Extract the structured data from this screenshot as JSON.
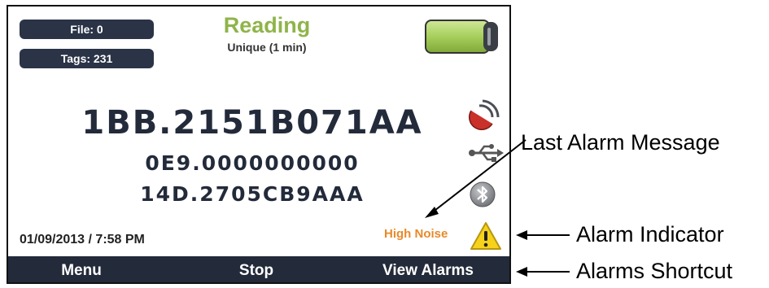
{
  "header": {
    "file_label": "File: 0",
    "tags_label": "Tags: 231",
    "status_title": "Reading",
    "status_subtitle": "Unique (1 min)"
  },
  "battery": {
    "level": 1.0,
    "color": "#a7cf5b"
  },
  "tags": {
    "main": "1BB.2151B071AA",
    "secondary_1": "0E9.0000000000",
    "secondary_2": "14D.2705CB9AAA"
  },
  "status_icons": [
    "antenna-icon",
    "usb-icon",
    "bluetooth-icon"
  ],
  "footer_info": {
    "datetime": "01/09/2013  /  7:58 PM",
    "alarm_message": "High Noise",
    "alarm_icon": "warning-icon"
  },
  "bottom_bar": {
    "menu_label": "Menu",
    "stop_label": "Stop",
    "alarms_label": "View Alarms"
  },
  "annotations": {
    "last_alarm_message": "Last Alarm Message",
    "alarm_indicator": "Alarm Indicator",
    "alarms_shortcut": "Alarms Shortcut"
  },
  "colors": {
    "accent_green": "#8fb44a",
    "bar_navy": "#232a3a",
    "alarm_orange": "#e8892a",
    "warning_yellow": "#f7d21c"
  }
}
